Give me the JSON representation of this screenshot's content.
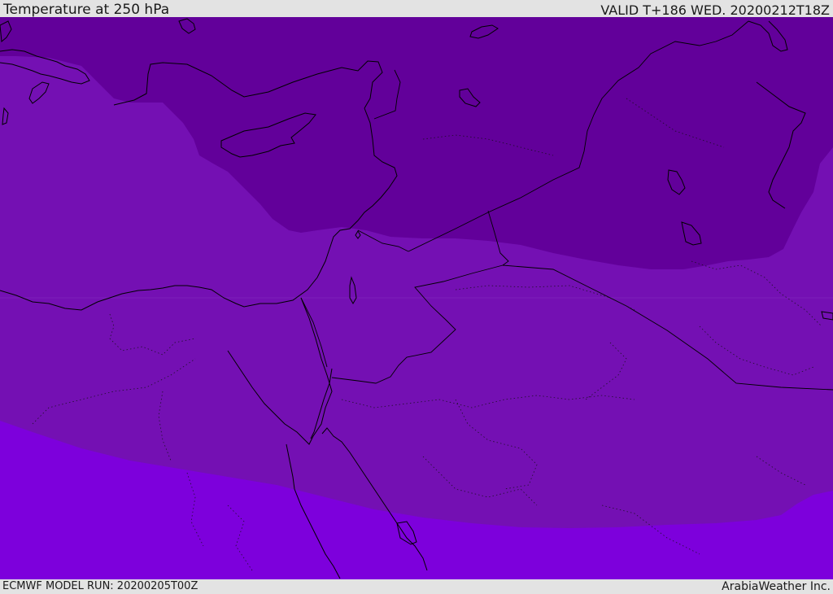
{
  "header": {
    "title": "Temperature at 250 hPa",
    "valid": "VALID T+186 WED. 20200212T18Z"
  },
  "footer": {
    "model_run": "ECMWF MODEL RUN: 20200205T00Z",
    "credit": "ArabiaWeather Inc."
  },
  "map": {
    "colors": {
      "coldest_band": "#62009a",
      "middle_band": "#7410b3",
      "warmest_band": "#7d00dc",
      "lines": "#000000"
    }
  }
}
